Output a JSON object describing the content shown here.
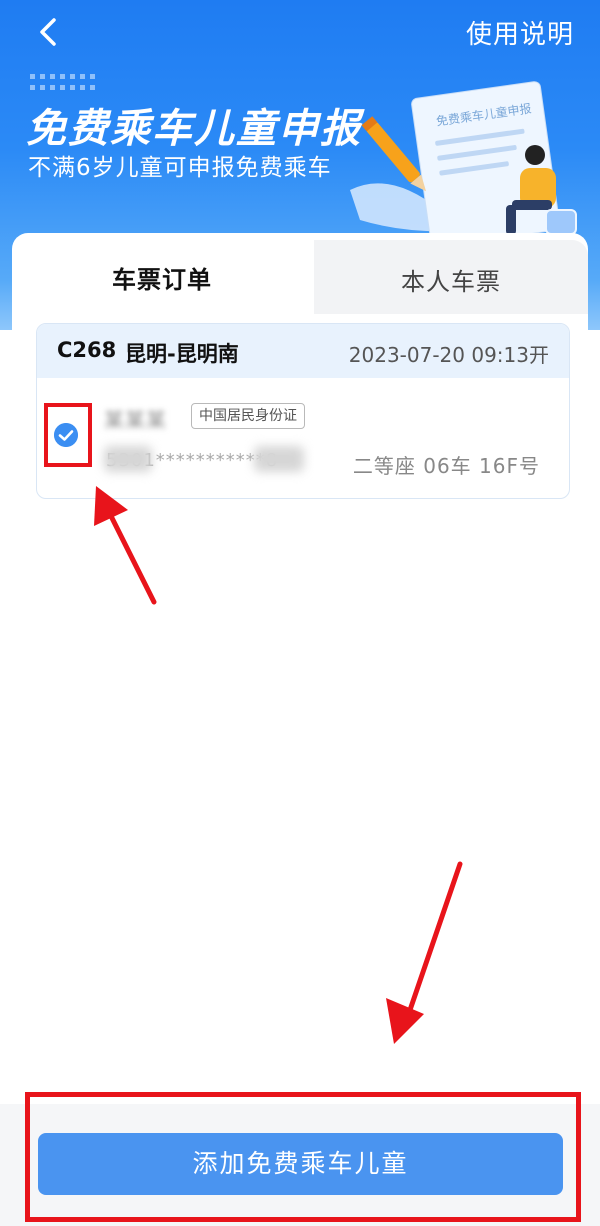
{
  "header": {
    "help_label": "使用说明",
    "title": "免费乘车儿童申报",
    "subtitle": "不满6岁儿童可申报免费乘车",
    "illustration_text": "免费乘车儿童申报"
  },
  "tabs": [
    {
      "label": "车票订单",
      "active": true
    },
    {
      "label": "本人车票",
      "active": false
    }
  ],
  "order": {
    "train_no": "C268",
    "route": "昆明-昆明南",
    "depart": "2023-07-20 09:13开",
    "passenger": {
      "name": "某某某",
      "id_type": "中国居民身份证",
      "id_no": "5301***********8",
      "seat": "二等座 06车 16F号",
      "selected": true
    }
  },
  "footer": {
    "add_button_label": "添加免费乘车儿童"
  },
  "colors": {
    "primary_blue": "#1f7cf2",
    "button_blue": "#4a94f0",
    "annotation_red": "#e8141b"
  }
}
